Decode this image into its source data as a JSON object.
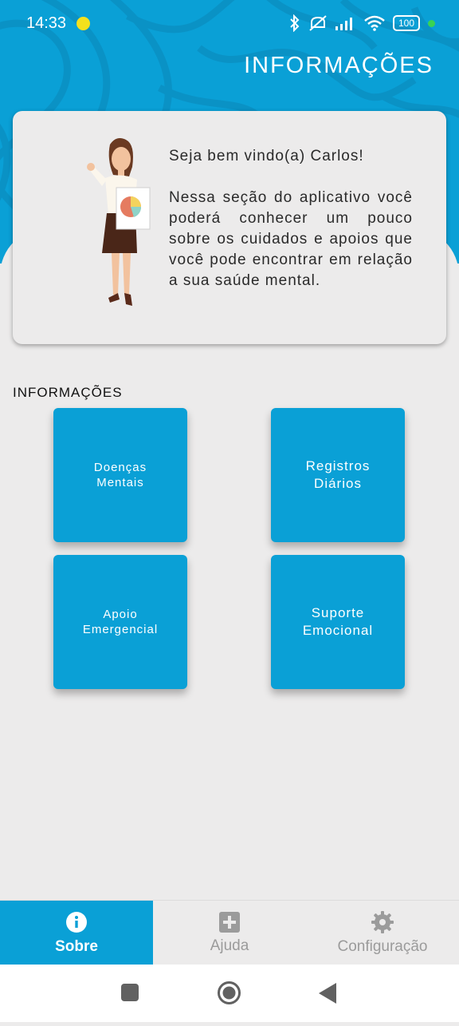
{
  "colors": {
    "primary": "#0aa0d6",
    "background": "#ecebeb",
    "nav_inactive": "#9b9b9b"
  },
  "status_bar": {
    "time": "14:33",
    "battery": "100"
  },
  "header": {
    "title": "INFORMAÇÕES"
  },
  "welcome": {
    "greeting": "Seja bem vindo(a) Carlos!",
    "message": "Nessa seção do aplicativo você poderá conhecer um pouco sobre os cuidados e apoios que você pode encontrar em relação a sua saúde mental."
  },
  "section": {
    "label": "INFORMAÇÕES"
  },
  "tiles": [
    {
      "label": "Doenças\nMentais"
    },
    {
      "label": "Registros\nDiários"
    },
    {
      "label": "Apoio\nEmergencial"
    },
    {
      "label": "Suporte\nEmocional"
    }
  ],
  "bottom_nav": [
    {
      "label": "Sobre",
      "icon": "info-icon",
      "active": true
    },
    {
      "label": "Ajuda",
      "icon": "plus-box-icon",
      "active": false
    },
    {
      "label": "Configuração",
      "icon": "gear-icon",
      "active": false
    }
  ],
  "system_nav": {
    "icons": [
      "recents-square-icon",
      "home-circle-icon",
      "back-triangle-icon"
    ]
  }
}
